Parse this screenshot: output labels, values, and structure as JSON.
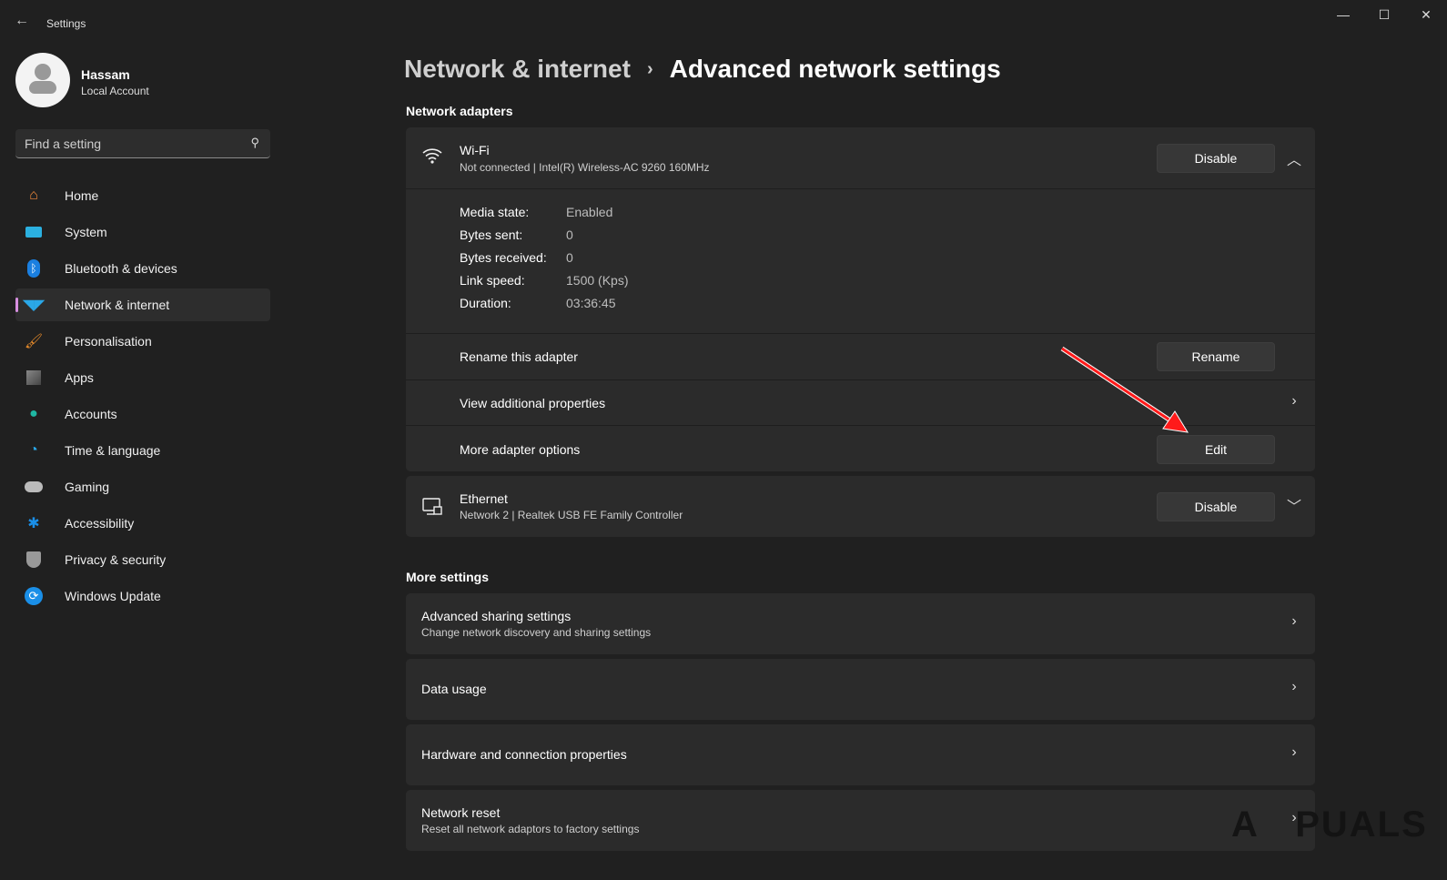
{
  "window": {
    "title": "Settings",
    "minimize": "—",
    "maximize": "☐",
    "close": "✕"
  },
  "user": {
    "name": "Hassam",
    "account": "Local Account"
  },
  "search": {
    "placeholder": "Find a setting"
  },
  "nav": [
    {
      "label": "Home",
      "icon": "home-icon"
    },
    {
      "label": "System",
      "icon": "system-icon"
    },
    {
      "label": "Bluetooth & devices",
      "icon": "bluetooth-icon"
    },
    {
      "label": "Network & internet",
      "icon": "wifi-icon",
      "selected": true
    },
    {
      "label": "Personalisation",
      "icon": "brush-icon"
    },
    {
      "label": "Apps",
      "icon": "apps-icon"
    },
    {
      "label": "Accounts",
      "icon": "accounts-icon"
    },
    {
      "label": "Time & language",
      "icon": "time-language-icon"
    },
    {
      "label": "Gaming",
      "icon": "gamepad-icon"
    },
    {
      "label": "Accessibility",
      "icon": "accessibility-icon"
    },
    {
      "label": "Privacy & security",
      "icon": "shield-icon"
    },
    {
      "label": "Windows Update",
      "icon": "update-icon"
    }
  ],
  "breadcrumb": {
    "parent": "Network & internet",
    "separator": "›",
    "current": "Advanced network settings"
  },
  "adapters": {
    "heading": "Network adapters",
    "wifi": {
      "name": "Wi-Fi",
      "detail": "Not connected | Intel(R) Wireless-AC 9260 160MHz",
      "button": "Disable",
      "props": [
        {
          "k": "Media state:",
          "v": "Enabled"
        },
        {
          "k": "Bytes sent:",
          "v": "0"
        },
        {
          "k": "Bytes received:",
          "v": "0"
        },
        {
          "k": "Link speed:",
          "v": "1500 (Kps)"
        },
        {
          "k": "Duration:",
          "v": "03:36:45"
        }
      ],
      "rename_label": "Rename this adapter",
      "rename_button": "Rename",
      "view_props": "View additional properties",
      "more_options": "More adapter options",
      "edit_button": "Edit"
    },
    "ethernet": {
      "name": "Ethernet",
      "detail": "Network 2 | Realtek USB FE Family Controller",
      "button": "Disable"
    }
  },
  "more": {
    "heading": "More settings",
    "items": [
      {
        "title": "Advanced sharing settings",
        "sub": "Change network discovery and sharing settings"
      },
      {
        "title": "Data usage"
      },
      {
        "title": "Hardware and connection properties"
      },
      {
        "title": "Network reset",
        "sub": "Reset all network adaptors to factory settings"
      }
    ]
  },
  "watermark": "APPUALS",
  "colors": {
    "accent": "#d78fe0",
    "arrow": "#ff1a1a"
  }
}
